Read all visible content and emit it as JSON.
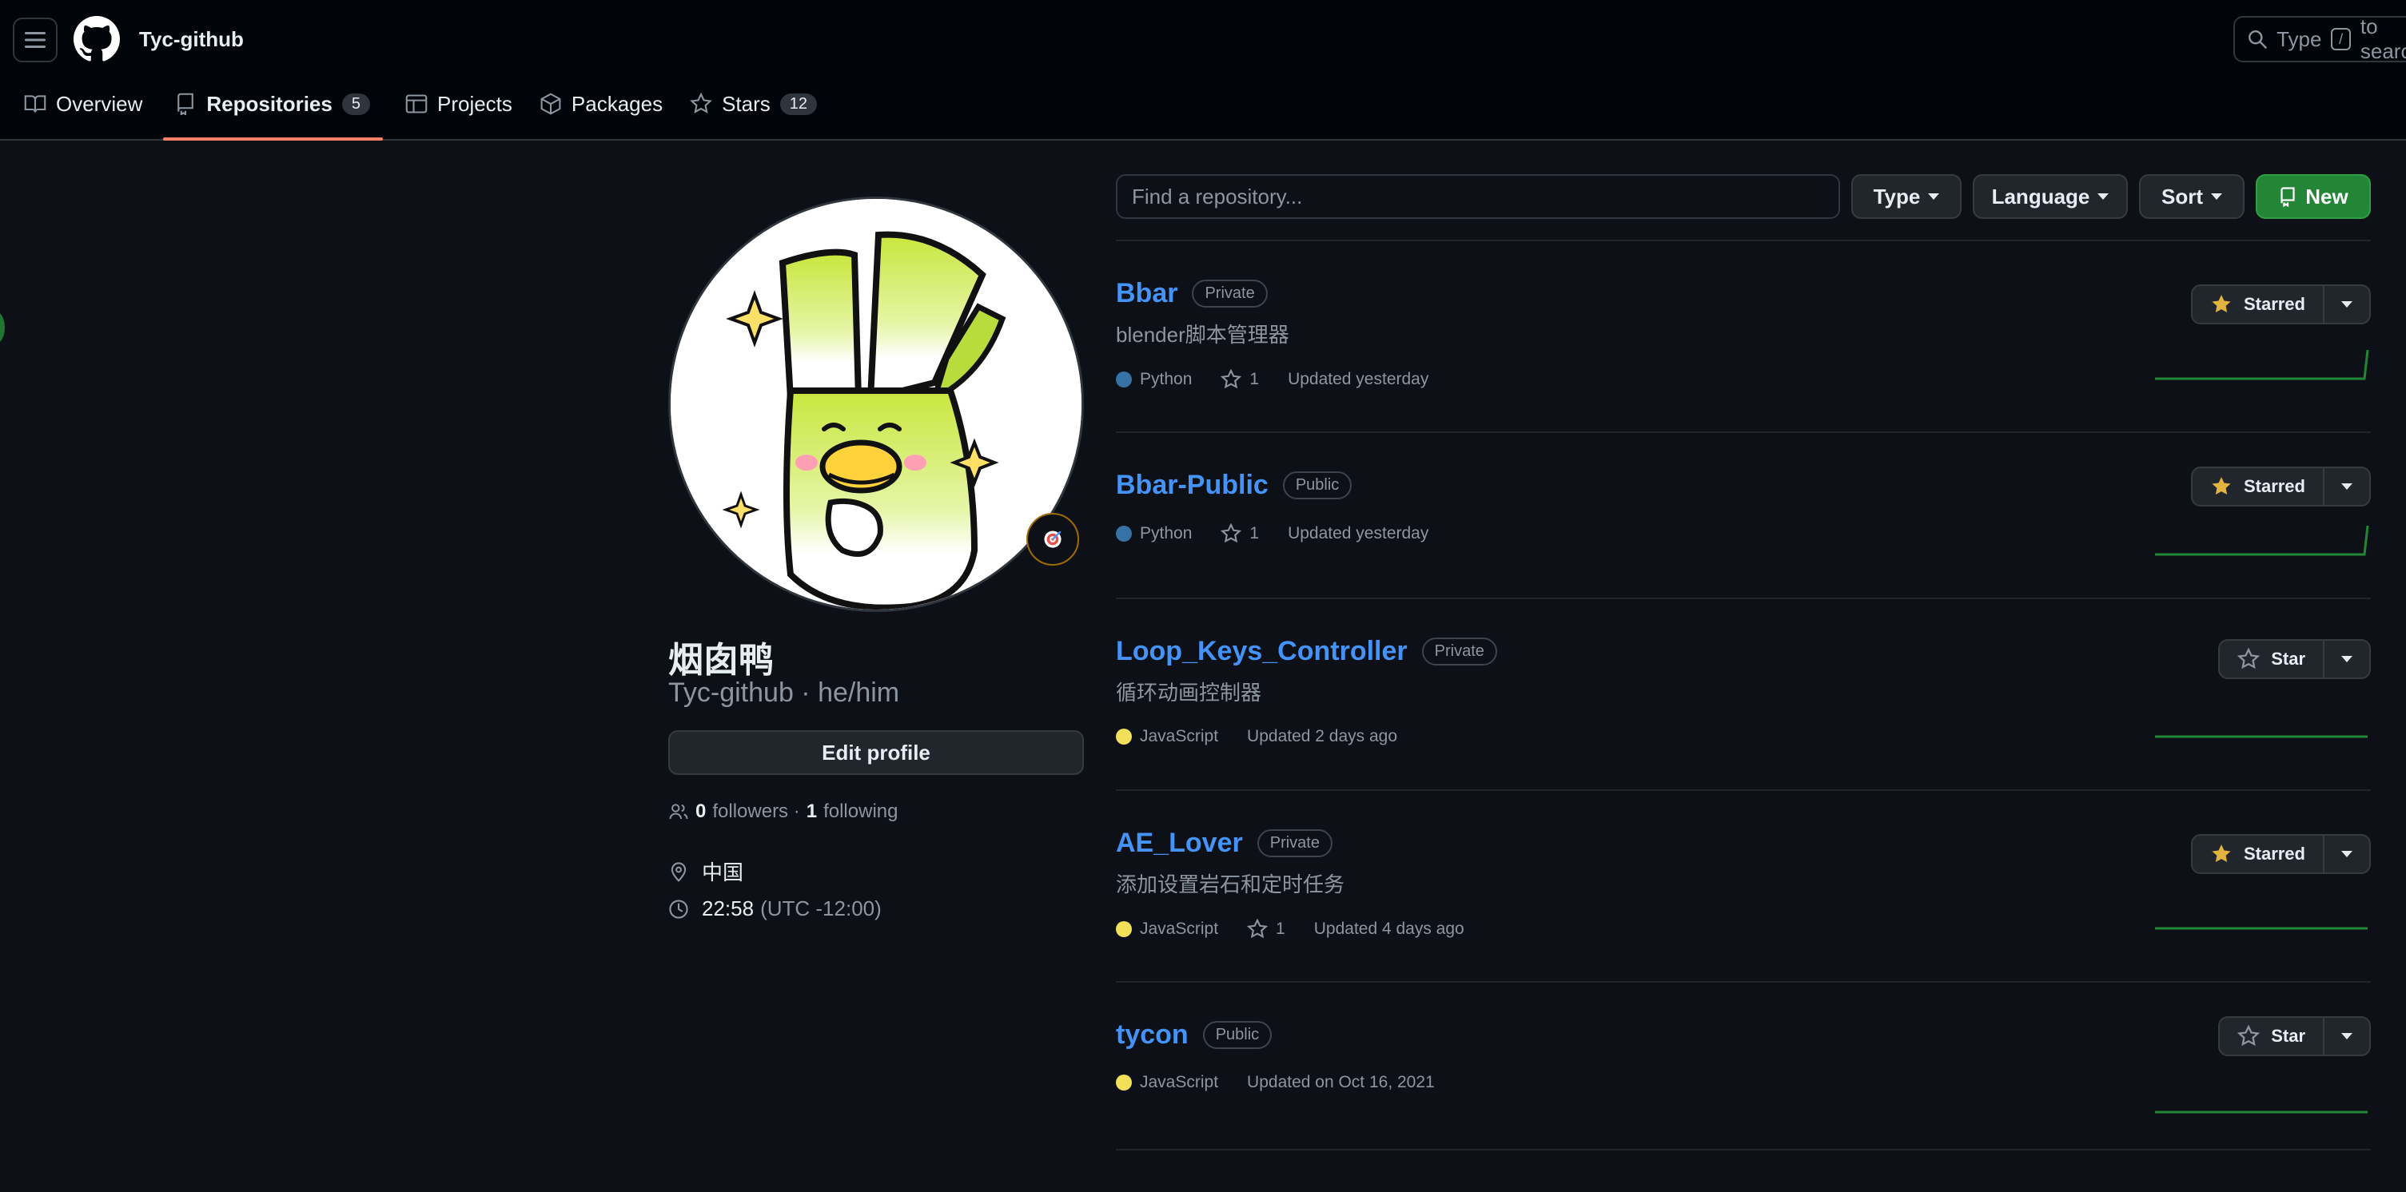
{
  "header": {
    "username": "Tyc-github",
    "search_prefix": "Type",
    "search_key": "/",
    "search_suffix": "to search"
  },
  "tabs": [
    {
      "label": "Overview"
    },
    {
      "label": "Repositories",
      "count": "5"
    },
    {
      "label": "Projects"
    },
    {
      "label": "Packages"
    },
    {
      "label": "Stars",
      "count": "12"
    }
  ],
  "profile": {
    "display_name": "烟囱鸭",
    "handle": "Tyc-github · he/him",
    "edit_label": "Edit profile",
    "followers_count": "0",
    "followers_label": "followers ·",
    "following_count": "1",
    "following_label": "following",
    "location": "中国",
    "time": "22:58",
    "timezone": "(UTC -12:00)"
  },
  "toolbar": {
    "find_placeholder": "Find a repository...",
    "type_label": "Type",
    "language_label": "Language",
    "sort_label": "Sort",
    "new_label": "New"
  },
  "repos": [
    {
      "name": "Bbar",
      "visibility": "Private",
      "description": "blender脚本管理器",
      "language": "Python",
      "stars": "1",
      "updated": "Updated yesterday",
      "star_label": "Starred"
    },
    {
      "name": "Bbar-Public",
      "visibility": "Public",
      "description": "",
      "language": "Python",
      "stars": "1",
      "updated": "Updated yesterday",
      "star_label": "Starred"
    },
    {
      "name": "Loop_Keys_Controller",
      "visibility": "Private",
      "description": "循环动画控制器",
      "language": "JavaScript",
      "stars": "",
      "updated": "Updated 2 days ago",
      "star_label": "Star"
    },
    {
      "name": "AE_Lover",
      "visibility": "Private",
      "description": "添加设置岩石和定时任务",
      "language": "JavaScript",
      "stars": "1",
      "updated": "Updated 4 days ago",
      "star_label": "Starred"
    },
    {
      "name": "tycon",
      "visibility": "Public",
      "description": "",
      "language": "JavaScript",
      "stars": "",
      "updated": "Updated on Oct 16, 2021",
      "star_label": "Star"
    }
  ],
  "colors": {
    "python": "#3572A5",
    "javascript": "#f1e05a",
    "accent": "#f78166",
    "link": "#4493f8",
    "starred": "#e3b341",
    "new_button": "#238636"
  }
}
